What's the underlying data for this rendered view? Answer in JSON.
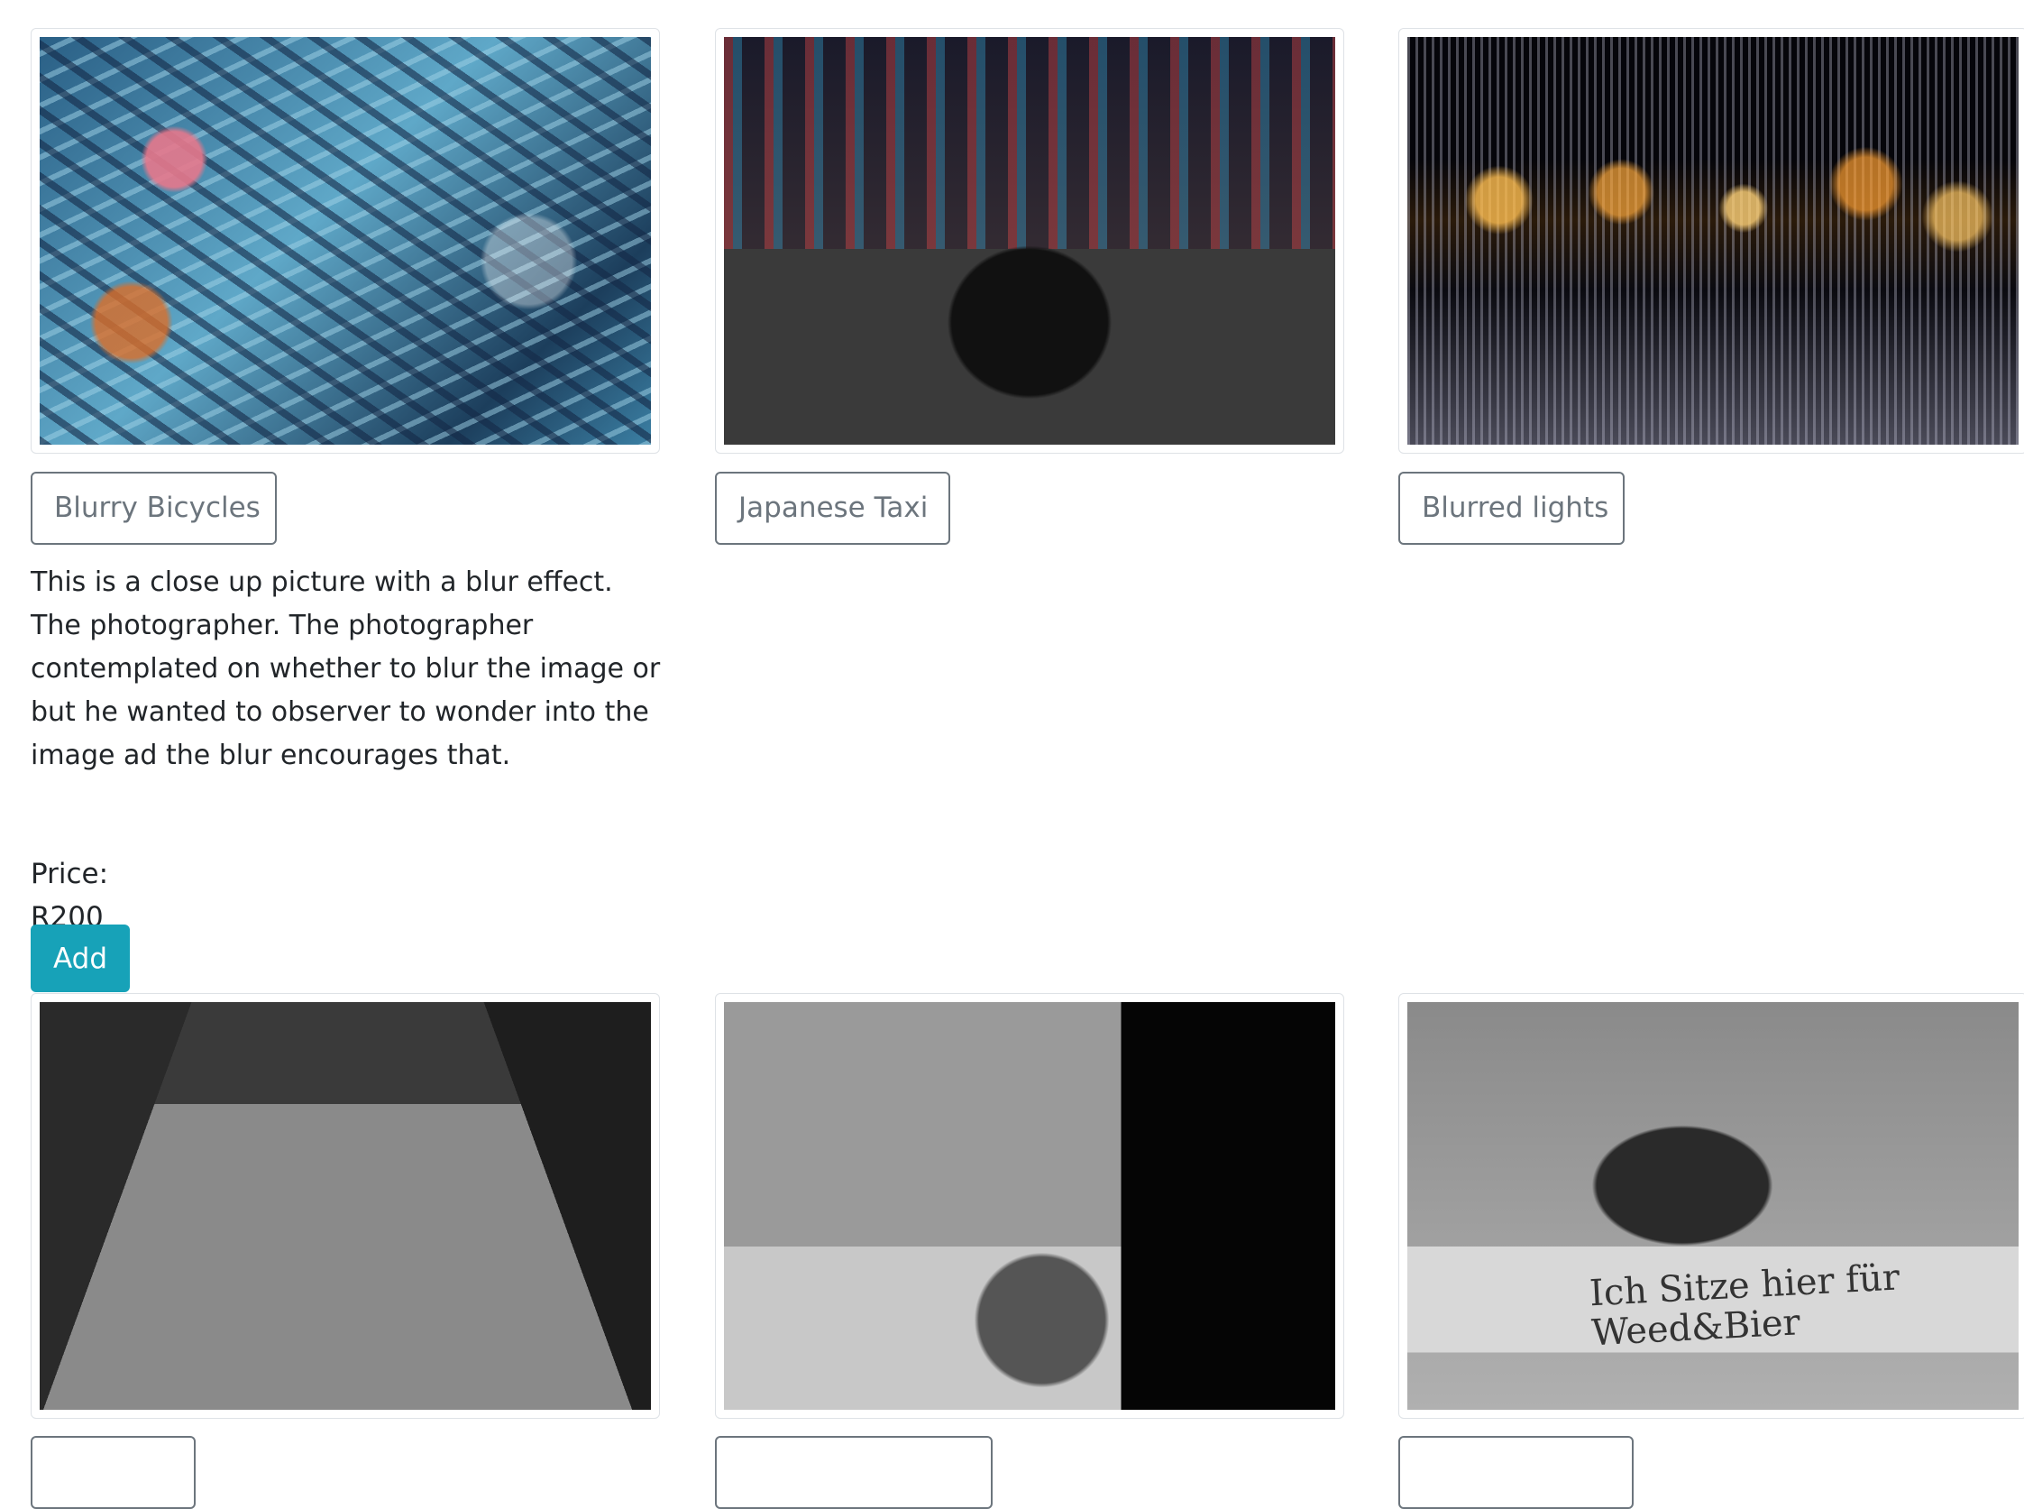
{
  "gallery": {
    "items": [
      {
        "title": "Blurry Bicycles",
        "description": "This is a close up picture with a blur effect. The photographer. The photographer contemplated on whether to blur the image or but he wanted to observer to wonder into the image ad the blur encourages that.",
        "price": "Price: R200",
        "add_label": "Add"
      },
      {
        "title": "Japanese Taxi"
      },
      {
        "title": "Blurred lights"
      }
    ],
    "row2_sign_text": "Ich Sitze hier für Weed&Bier"
  }
}
